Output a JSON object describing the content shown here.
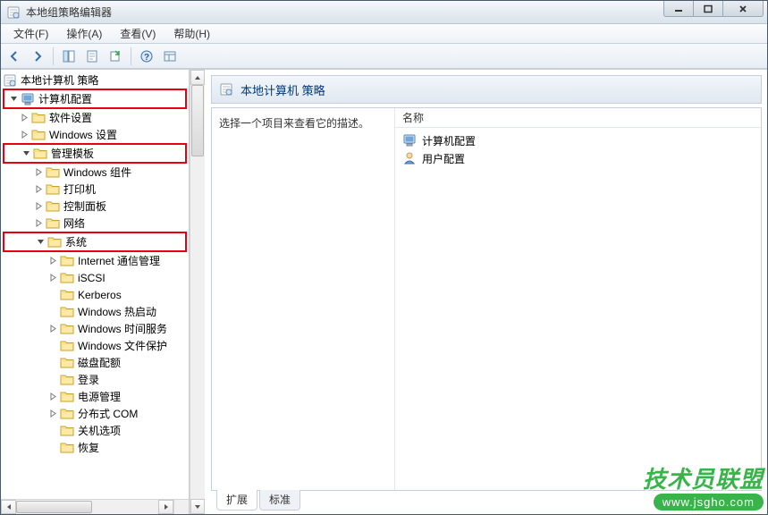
{
  "window": {
    "title": "本地组策略编辑器"
  },
  "menu": {
    "file": "文件(F)",
    "action": "操作(A)",
    "view": "查看(V)",
    "help": "帮助(H)"
  },
  "tree": {
    "root": "本地计算机 策略",
    "computer_config": "计算机配置",
    "software_settings": "软件设置",
    "windows_settings": "Windows 设置",
    "admin_templates": "管理模板",
    "windows_components": "Windows 组件",
    "printers": "打印机",
    "control_panel": "控制面板",
    "network": "网络",
    "system": "系统",
    "internet_comm": "Internet 通信管理",
    "iscsi": "iSCSI",
    "kerberos": "Kerberos",
    "windows_hotstart": "Windows 热启动",
    "windows_time": "Windows 时间服务",
    "windows_fileprotect": "Windows 文件保护",
    "disk_quota": "磁盘配额",
    "logon": "登录",
    "power": "电源管理",
    "dcom": "分布式 COM",
    "shutdown_options": "关机选项",
    "recovery": "恢复"
  },
  "right": {
    "header": "本地计算机 策略",
    "description": "选择一个项目来查看它的描述。",
    "column_name": "名称",
    "items": {
      "0": {
        "label": "计算机配置"
      },
      "1": {
        "label": "用户配置"
      }
    }
  },
  "tabs": {
    "extended": "扩展",
    "standard": "标准"
  },
  "watermark": {
    "title": "技术员联盟",
    "url": "www.jsgho.com"
  }
}
